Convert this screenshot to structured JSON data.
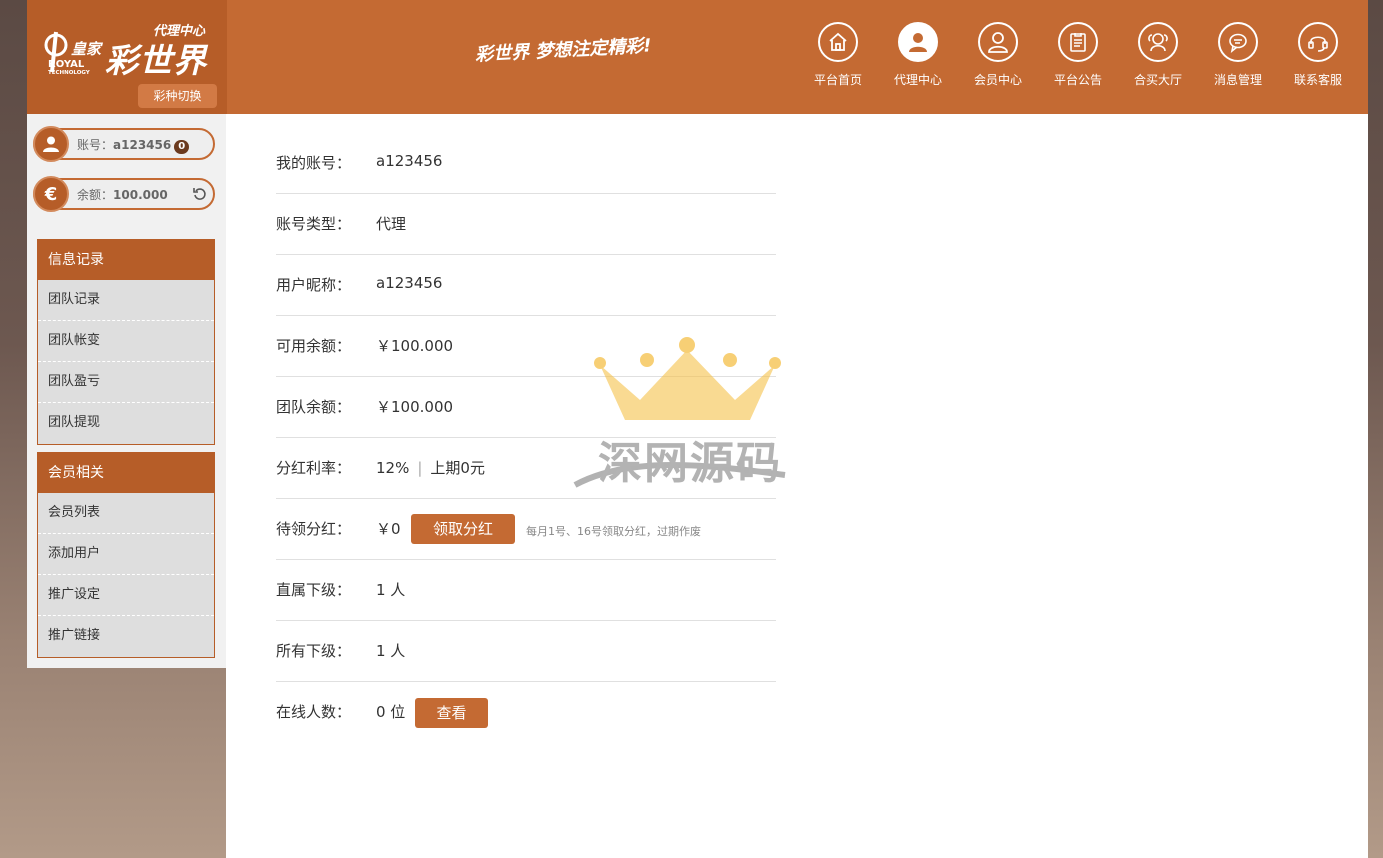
{
  "logo": {
    "sub": "代理中心",
    "main": "彩世界",
    "brand": "皇家",
    "en_line1": "ROYAL",
    "en_line2": "TECHNOLOGY"
  },
  "header": {
    "switch_label": "彩种切换",
    "slogan": "彩世界 梦想注定精彩!",
    "nav": [
      {
        "label": "平台首页",
        "icon": "home-icon"
      },
      {
        "label": "代理中心",
        "icon": "agent-icon"
      },
      {
        "label": "会员中心",
        "icon": "member-icon"
      },
      {
        "label": "平台公告",
        "icon": "notice-icon"
      },
      {
        "label": "合买大厅",
        "icon": "group-buy-icon"
      },
      {
        "label": "消息管理",
        "icon": "message-icon"
      },
      {
        "label": "联系客服",
        "icon": "support-icon"
      }
    ],
    "active_nav": "代理中心"
  },
  "account": {
    "label": "账号：",
    "value": "a123456",
    "badge": "0",
    "balance_label": "余额：",
    "balance_value": "100.000"
  },
  "sidebar": {
    "groups": [
      {
        "title": "信息记录",
        "items": [
          "团队记录",
          "团队帐变",
          "团队盈亏",
          "团队提现"
        ]
      },
      {
        "title": "会员相关",
        "items": [
          "会员列表",
          "添加用户",
          "推广设定",
          "推广链接"
        ]
      }
    ]
  },
  "info": {
    "account": {
      "label": "我的账号：",
      "value": "a123456"
    },
    "type": {
      "label": "账号类型：",
      "value": "代理"
    },
    "nickname": {
      "label": "用户昵称：",
      "value": "a123456"
    },
    "available": {
      "label": "可用余额：",
      "value": "￥100.000"
    },
    "team": {
      "label": "团队余额：",
      "value": "￥100.000"
    },
    "dividend_rate": {
      "label": "分红利率：",
      "value": "12%",
      "sep": "|",
      "last": "上期0元"
    },
    "pending": {
      "label": "待领分红：",
      "value": "￥0",
      "button": "领取分红",
      "note": "每月1号、16号领取分红，过期作废"
    },
    "direct": {
      "label": "直属下级：",
      "value": "1 人"
    },
    "all": {
      "label": "所有下级：",
      "value": "1 人"
    },
    "online": {
      "label": "在线人数：",
      "value": "0 位",
      "button": "查看"
    }
  },
  "watermark": {
    "text": "深网源码"
  },
  "colors": {
    "brand": "#c46a33",
    "brand_dark": "#b65d28",
    "watermark": "#f5c048"
  }
}
